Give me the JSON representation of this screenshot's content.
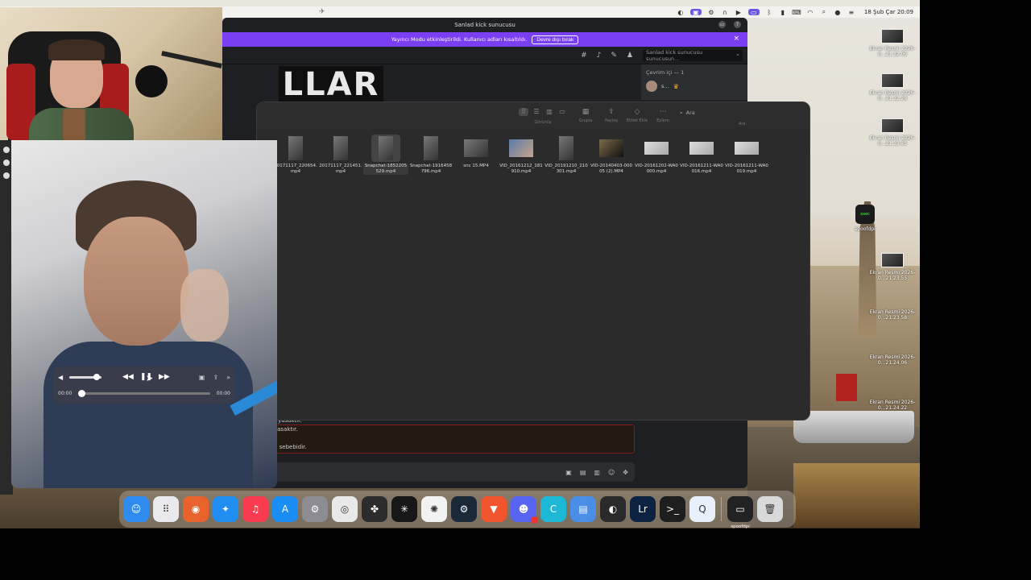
{
  "menubar": {
    "clock": "18 Şub Çar 20:09"
  },
  "discord": {
    "window_title": "Sanlad kick sunucusu",
    "streamer_mode_text": "Yayıncı Modu etkinleştirildi. Kullanıcı adları kısaltıldı.",
    "streamer_mode_button": "Devre dışı bırak",
    "search_placeholder": "Sanlad kick sunucusu sunucusun...",
    "banner_text": "LLAR",
    "online_label": "Çevrim içi — 1",
    "member_name": "s...",
    "chat_lines": [
      "r yasaktır.",
      "yasaktır.",
      "r.",
      "n sebebidir."
    ]
  },
  "finder": {
    "toolbar": {
      "view_label": "Görünüş",
      "group_label": "Grupla",
      "share_label": "Paylaş",
      "tag_label": "Etiket Ekle",
      "action_label": "Eylem",
      "search_placeholder": "Ara",
      "search_label": "Ara"
    },
    "files": [
      {
        "name": "20171117_220654.mp4",
        "thumb": "portrait"
      },
      {
        "name": "20171117_221451.mp4",
        "thumb": "portrait"
      },
      {
        "name": "Snapchat-1852205529.mp4",
        "thumb": "portrait",
        "selected": true
      },
      {
        "name": "Snapchat-1916458796.mp4",
        "thumb": "portrait"
      },
      {
        "name": "snc 15.MP4",
        "thumb": "landscape"
      },
      {
        "name": "VID_20161212_181910.mp4",
        "thumb": "people"
      },
      {
        "name": "VID_20191210_210301.mp4",
        "thumb": "portrait"
      },
      {
        "name": "VID-20140403-00005 (2).MP4",
        "thumb": "dark"
      },
      {
        "name": "VID-20161202-WA0000.mp4",
        "thumb": "wide"
      },
      {
        "name": "VID-20161211-WA0016.mp4",
        "thumb": "wide"
      },
      {
        "name": "VID-20161211-WA0019.mp4",
        "thumb": "wide"
      }
    ]
  },
  "player": {
    "time_elapsed": "00:00",
    "time_total": "00:00",
    "volume_level": 0.85,
    "progress": 0.0
  },
  "desktop_icons": [
    {
      "label": "Ekran Resmi 2026-0...21.22.06"
    },
    {
      "label": "Ekran Resmi 2026-0...21.22.28"
    },
    {
      "label": "Ekran Resmi 2026-0...21.23.45"
    },
    {
      "label": "spoofdpi"
    },
    {
      "label": "Ekran Resmi 2026-0...21.23.55"
    },
    {
      "label": "Ekran Resmi 2026-0...21.23.58"
    },
    {
      "label": "Ekran Resmi 2026-0...21.24.06"
    },
    {
      "label": "Ekran Resmi 2026-0...21.24.22"
    }
  ],
  "dock": {
    "apps": [
      {
        "name": "finder-icon",
        "glyph": "☺",
        "color": "#2e8cf0"
      },
      {
        "name": "launchpad-icon",
        "glyph": "⠿",
        "color": "#e9e9ee"
      },
      {
        "name": "firefox-icon",
        "glyph": "◉",
        "color": "#e8632b"
      },
      {
        "name": "safari-icon",
        "glyph": "✦",
        "color": "#1f8df2"
      },
      {
        "name": "music-icon",
        "glyph": "♫",
        "color": "#fa3b50"
      },
      {
        "name": "app-store-icon",
        "glyph": "A",
        "color": "#1b8ef5"
      },
      {
        "name": "system-settings-icon",
        "glyph": "⚙",
        "color": "#8c8c92"
      },
      {
        "name": "chrome-icon",
        "glyph": "◎",
        "color": "#e9e9e9"
      },
      {
        "name": "davinci-resolve-icon",
        "glyph": "✤",
        "color": "#2c2c2c"
      },
      {
        "name": "perplexity-icon",
        "glyph": "✳",
        "color": "#171717"
      },
      {
        "name": "chatgpt-icon",
        "glyph": "✺",
        "color": "#f2f2f2"
      },
      {
        "name": "steam-icon",
        "glyph": "⚙",
        "color": "#1b2838"
      },
      {
        "name": "brave-icon",
        "glyph": "▼",
        "color": "#f2542d"
      },
      {
        "name": "discord-icon",
        "glyph": "☻",
        "color": "#5865f2"
      },
      {
        "name": "canva-icon",
        "glyph": "C",
        "color": "#1cb8d6"
      },
      {
        "name": "preview-icon",
        "glyph": "▤",
        "color": "#4a8ee8"
      },
      {
        "name": "obs-icon",
        "glyph": "◐",
        "color": "#2a2a2a"
      },
      {
        "name": "lightroom-icon",
        "glyph": "Lr",
        "color": "#0b2240"
      },
      {
        "name": "terminal-icon",
        "glyph": ">_",
        "color": "#1e1e1e"
      },
      {
        "name": "quicktime-icon",
        "glyph": "Q",
        "color": "#e8f1fb"
      },
      {
        "name": "spoofdpi-dock-icon",
        "glyph": "▭",
        "color": "#222"
      },
      {
        "name": "trash-icon",
        "glyph": "🗑",
        "color": "#d9d9d9"
      }
    ],
    "spoofdpi_label": "spoofdpi"
  }
}
